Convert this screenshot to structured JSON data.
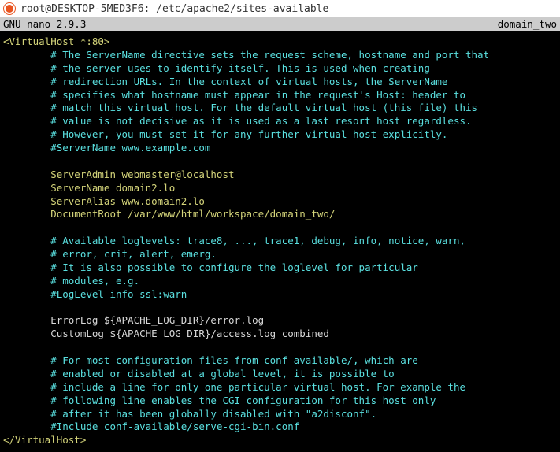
{
  "title_bar": {
    "text": "root@DESKTOP-5MED3F6: /etc/apache2/sites-available"
  },
  "nano_bar": {
    "left": "  GNU nano 2.9.3",
    "right": "domain_two"
  },
  "lines": [
    {
      "segments": [
        {
          "c": "yellow",
          "t": "<VirtualHost *:80>"
        }
      ]
    },
    {
      "segments": [
        {
          "c": "cyan",
          "t": "        # The ServerName directive sets the request scheme, hostname and port that"
        }
      ]
    },
    {
      "segments": [
        {
          "c": "cyan",
          "t": "        # the server uses to identify itself. This is used when creating"
        }
      ]
    },
    {
      "segments": [
        {
          "c": "cyan",
          "t": "        # redirection URLs. In the context of virtual hosts, the ServerName"
        }
      ]
    },
    {
      "segments": [
        {
          "c": "cyan",
          "t": "        # specifies what hostname must appear in the request's Host: header to"
        }
      ]
    },
    {
      "segments": [
        {
          "c": "cyan",
          "t": "        # match this virtual host. For the default virtual host (this file) this"
        }
      ]
    },
    {
      "segments": [
        {
          "c": "cyan",
          "t": "        # value is not decisive as it is used as a last resort host regardless."
        }
      ]
    },
    {
      "segments": [
        {
          "c": "cyan",
          "t": "        # However, you must set it for any further virtual host explicitly."
        }
      ]
    },
    {
      "segments": [
        {
          "c": "cyan",
          "t": "        #ServerName www.example.com"
        }
      ]
    },
    {
      "segments": [
        {
          "c": "white",
          "t": " "
        }
      ]
    },
    {
      "segments": [
        {
          "c": "yellow",
          "t": "        ServerAdmin webmaster@localhost"
        }
      ]
    },
    {
      "segments": [
        {
          "c": "yellow",
          "t": "        ServerName domain2.lo"
        }
      ]
    },
    {
      "segments": [
        {
          "c": "yellow",
          "t": "        ServerAlias www.domain2.lo"
        }
      ]
    },
    {
      "segments": [
        {
          "c": "yellow",
          "t": "        DocumentRoot /var/www/html/workspace/domain_two/"
        }
      ]
    },
    {
      "segments": [
        {
          "c": "white",
          "t": " "
        }
      ]
    },
    {
      "segments": [
        {
          "c": "cyan",
          "t": "        # Available loglevels: trace8, ..., trace1, debug, info, notice, warn,"
        }
      ]
    },
    {
      "segments": [
        {
          "c": "cyan",
          "t": "        # error, crit, alert, emerg."
        }
      ]
    },
    {
      "segments": [
        {
          "c": "cyan",
          "t": "        # It is also possible to configure the loglevel for particular"
        }
      ]
    },
    {
      "segments": [
        {
          "c": "cyan",
          "t": "        # modules, e.g."
        }
      ]
    },
    {
      "segments": [
        {
          "c": "cyan",
          "t": "        #LogLevel info ssl:warn"
        }
      ]
    },
    {
      "segments": [
        {
          "c": "white",
          "t": " "
        }
      ]
    },
    {
      "segments": [
        {
          "c": "white",
          "t": "        ErrorLog ${APACHE_LOG_DIR}/error.log"
        }
      ]
    },
    {
      "segments": [
        {
          "c": "white",
          "t": "        CustomLog ${APACHE_LOG_DIR}/access.log combined"
        }
      ]
    },
    {
      "segments": [
        {
          "c": "white",
          "t": " "
        }
      ]
    },
    {
      "segments": [
        {
          "c": "cyan",
          "t": "        # For most configuration files from conf-available/, which are"
        }
      ]
    },
    {
      "segments": [
        {
          "c": "cyan",
          "t": "        # enabled or disabled at a global level, it is possible to"
        }
      ]
    },
    {
      "segments": [
        {
          "c": "cyan",
          "t": "        # include a line for only one particular virtual host. For example the"
        }
      ]
    },
    {
      "segments": [
        {
          "c": "cyan",
          "t": "        # following line enables the CGI configuration for this host only"
        }
      ]
    },
    {
      "segments": [
        {
          "c": "cyan",
          "t": "        # after it has been globally disabled with \"a2disconf\"."
        }
      ]
    },
    {
      "segments": [
        {
          "c": "cyan",
          "t": "        #Include conf-available/serve-cgi-bin.conf"
        }
      ]
    },
    {
      "segments": [
        {
          "c": "yellow",
          "t": "</VirtualHost>"
        }
      ]
    }
  ]
}
